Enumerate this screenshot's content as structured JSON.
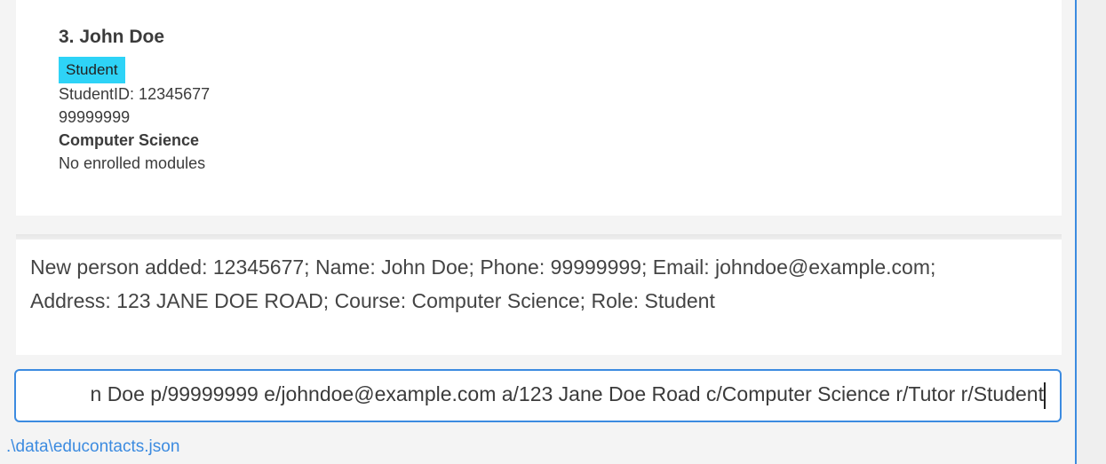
{
  "person_card": {
    "name": "3. John Doe",
    "role_tag": "Student",
    "student_id": "StudentID: 12345677",
    "phone": "99999999",
    "course": "Computer Science",
    "modules": "No enrolled modules"
  },
  "result_display": {
    "line1": "New person added: 12345677; Name: John Doe; Phone: 99999999; Email: johndoe@example.com;",
    "line2": "Address: 123 JANE DOE ROAD; Course: Computer Science; Role: Student"
  },
  "command_box": {
    "value": "n Doe p/99999999 e/johndoe@example.com a/123 Jane Doe Road c/Computer Science r/Tutor r/Student"
  },
  "status_bar": {
    "file_path": ".\\data\\educontacts.json"
  },
  "colors": {
    "role_tag_bg": "#2ed3f7",
    "accent": "#3c8be0"
  }
}
